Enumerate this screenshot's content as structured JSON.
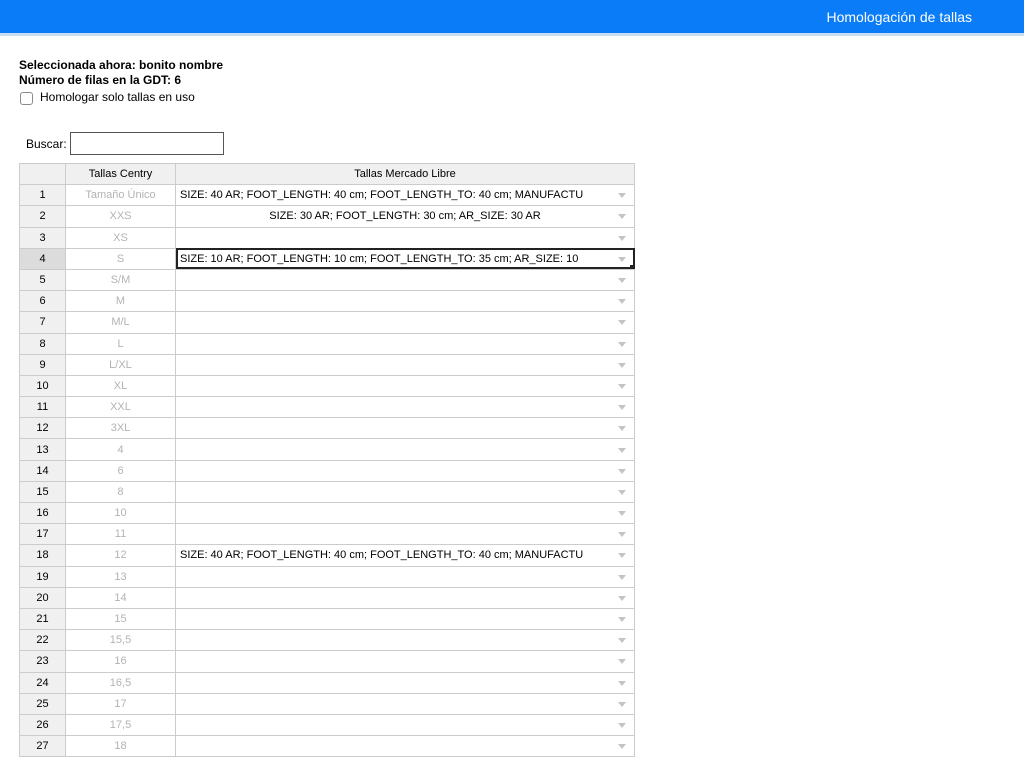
{
  "header": {
    "title": "Homologación de tallas"
  },
  "info": {
    "selected_line": "Seleccionada ahora: bonito nombre",
    "rows_line": "Número de filas en la GDT: 6",
    "checkbox_label": "Homologar solo tallas en uso"
  },
  "search": {
    "label": "Buscar:",
    "value": ""
  },
  "table": {
    "headers": {
      "centry": "Tallas Centry",
      "ml": "Tallas Mercado Libre"
    },
    "rows": [
      {
        "num": "1",
        "centry": "Tamaño Único",
        "ml": "SIZE: 40 AR; FOOT_LENGTH: 40 cm; FOOT_LENGTH_TO: 40 cm; MANUFACTU"
      },
      {
        "num": "2",
        "centry": "XXS",
        "ml": "SIZE: 30 AR; FOOT_LENGTH: 30 cm; AR_SIZE: 30 AR"
      },
      {
        "num": "3",
        "centry": "XS",
        "ml": ""
      },
      {
        "num": "4",
        "centry": "S",
        "ml": "SIZE: 10 AR; FOOT_LENGTH: 10 cm; FOOT_LENGTH_TO: 35 cm; AR_SIZE: 10"
      },
      {
        "num": "5",
        "centry": "S/M",
        "ml": ""
      },
      {
        "num": "6",
        "centry": "M",
        "ml": ""
      },
      {
        "num": "7",
        "centry": "M/L",
        "ml": ""
      },
      {
        "num": "8",
        "centry": "L",
        "ml": ""
      },
      {
        "num": "9",
        "centry": "L/XL",
        "ml": ""
      },
      {
        "num": "10",
        "centry": "XL",
        "ml": ""
      },
      {
        "num": "11",
        "centry": "XXL",
        "ml": ""
      },
      {
        "num": "12",
        "centry": "3XL",
        "ml": ""
      },
      {
        "num": "13",
        "centry": "4",
        "ml": ""
      },
      {
        "num": "14",
        "centry": "6",
        "ml": ""
      },
      {
        "num": "15",
        "centry": "8",
        "ml": ""
      },
      {
        "num": "16",
        "centry": "10",
        "ml": ""
      },
      {
        "num": "17",
        "centry": "11",
        "ml": ""
      },
      {
        "num": "18",
        "centry": "12",
        "ml": "SIZE: 40 AR; FOOT_LENGTH: 40 cm; FOOT_LENGTH_TO: 40 cm; MANUFACTU"
      },
      {
        "num": "19",
        "centry": "13",
        "ml": ""
      },
      {
        "num": "20",
        "centry": "14",
        "ml": ""
      },
      {
        "num": "21",
        "centry": "15",
        "ml": ""
      },
      {
        "num": "22",
        "centry": "15,5",
        "ml": ""
      },
      {
        "num": "23",
        "centry": "16",
        "ml": ""
      },
      {
        "num": "24",
        "centry": "16,5",
        "ml": ""
      },
      {
        "num": "25",
        "centry": "17",
        "ml": ""
      },
      {
        "num": "26",
        "centry": "17,5",
        "ml": ""
      },
      {
        "num": "27",
        "centry": "18",
        "ml": ""
      }
    ]
  }
}
